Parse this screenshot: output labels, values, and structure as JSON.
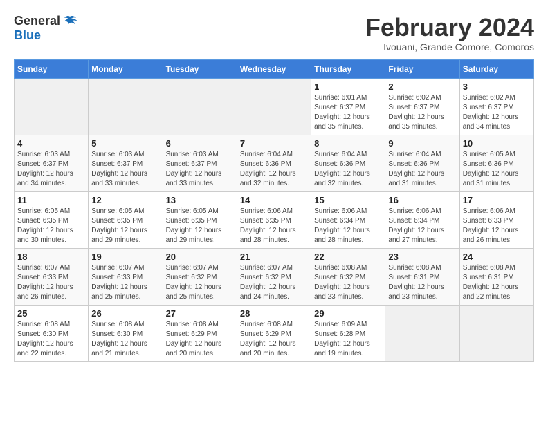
{
  "header": {
    "logo_general": "General",
    "logo_blue": "Blue",
    "month_title": "February 2024",
    "location": "Ivouani, Grande Comore, Comoros"
  },
  "days_of_week": [
    "Sunday",
    "Monday",
    "Tuesday",
    "Wednesday",
    "Thursday",
    "Friday",
    "Saturday"
  ],
  "weeks": [
    [
      {
        "day": "",
        "info": ""
      },
      {
        "day": "",
        "info": ""
      },
      {
        "day": "",
        "info": ""
      },
      {
        "day": "",
        "info": ""
      },
      {
        "day": "1",
        "info": "Sunrise: 6:01 AM\nSunset: 6:37 PM\nDaylight: 12 hours\nand 35 minutes."
      },
      {
        "day": "2",
        "info": "Sunrise: 6:02 AM\nSunset: 6:37 PM\nDaylight: 12 hours\nand 35 minutes."
      },
      {
        "day": "3",
        "info": "Sunrise: 6:02 AM\nSunset: 6:37 PM\nDaylight: 12 hours\nand 34 minutes."
      }
    ],
    [
      {
        "day": "4",
        "info": "Sunrise: 6:03 AM\nSunset: 6:37 PM\nDaylight: 12 hours\nand 34 minutes."
      },
      {
        "day": "5",
        "info": "Sunrise: 6:03 AM\nSunset: 6:37 PM\nDaylight: 12 hours\nand 33 minutes."
      },
      {
        "day": "6",
        "info": "Sunrise: 6:03 AM\nSunset: 6:37 PM\nDaylight: 12 hours\nand 33 minutes."
      },
      {
        "day": "7",
        "info": "Sunrise: 6:04 AM\nSunset: 6:36 PM\nDaylight: 12 hours\nand 32 minutes."
      },
      {
        "day": "8",
        "info": "Sunrise: 6:04 AM\nSunset: 6:36 PM\nDaylight: 12 hours\nand 32 minutes."
      },
      {
        "day": "9",
        "info": "Sunrise: 6:04 AM\nSunset: 6:36 PM\nDaylight: 12 hours\nand 31 minutes."
      },
      {
        "day": "10",
        "info": "Sunrise: 6:05 AM\nSunset: 6:36 PM\nDaylight: 12 hours\nand 31 minutes."
      }
    ],
    [
      {
        "day": "11",
        "info": "Sunrise: 6:05 AM\nSunset: 6:35 PM\nDaylight: 12 hours\nand 30 minutes."
      },
      {
        "day": "12",
        "info": "Sunrise: 6:05 AM\nSunset: 6:35 PM\nDaylight: 12 hours\nand 29 minutes."
      },
      {
        "day": "13",
        "info": "Sunrise: 6:05 AM\nSunset: 6:35 PM\nDaylight: 12 hours\nand 29 minutes."
      },
      {
        "day": "14",
        "info": "Sunrise: 6:06 AM\nSunset: 6:35 PM\nDaylight: 12 hours\nand 28 minutes."
      },
      {
        "day": "15",
        "info": "Sunrise: 6:06 AM\nSunset: 6:34 PM\nDaylight: 12 hours\nand 28 minutes."
      },
      {
        "day": "16",
        "info": "Sunrise: 6:06 AM\nSunset: 6:34 PM\nDaylight: 12 hours\nand 27 minutes."
      },
      {
        "day": "17",
        "info": "Sunrise: 6:06 AM\nSunset: 6:33 PM\nDaylight: 12 hours\nand 26 minutes."
      }
    ],
    [
      {
        "day": "18",
        "info": "Sunrise: 6:07 AM\nSunset: 6:33 PM\nDaylight: 12 hours\nand 26 minutes."
      },
      {
        "day": "19",
        "info": "Sunrise: 6:07 AM\nSunset: 6:33 PM\nDaylight: 12 hours\nand 25 minutes."
      },
      {
        "day": "20",
        "info": "Sunrise: 6:07 AM\nSunset: 6:32 PM\nDaylight: 12 hours\nand 25 minutes."
      },
      {
        "day": "21",
        "info": "Sunrise: 6:07 AM\nSunset: 6:32 PM\nDaylight: 12 hours\nand 24 minutes."
      },
      {
        "day": "22",
        "info": "Sunrise: 6:08 AM\nSunset: 6:32 PM\nDaylight: 12 hours\nand 23 minutes."
      },
      {
        "day": "23",
        "info": "Sunrise: 6:08 AM\nSunset: 6:31 PM\nDaylight: 12 hours\nand 23 minutes."
      },
      {
        "day": "24",
        "info": "Sunrise: 6:08 AM\nSunset: 6:31 PM\nDaylight: 12 hours\nand 22 minutes."
      }
    ],
    [
      {
        "day": "25",
        "info": "Sunrise: 6:08 AM\nSunset: 6:30 PM\nDaylight: 12 hours\nand 22 minutes."
      },
      {
        "day": "26",
        "info": "Sunrise: 6:08 AM\nSunset: 6:30 PM\nDaylight: 12 hours\nand 21 minutes."
      },
      {
        "day": "27",
        "info": "Sunrise: 6:08 AM\nSunset: 6:29 PM\nDaylight: 12 hours\nand 20 minutes."
      },
      {
        "day": "28",
        "info": "Sunrise: 6:08 AM\nSunset: 6:29 PM\nDaylight: 12 hours\nand 20 minutes."
      },
      {
        "day": "29",
        "info": "Sunrise: 6:09 AM\nSunset: 6:28 PM\nDaylight: 12 hours\nand 19 minutes."
      },
      {
        "day": "",
        "info": ""
      },
      {
        "day": "",
        "info": ""
      }
    ]
  ]
}
